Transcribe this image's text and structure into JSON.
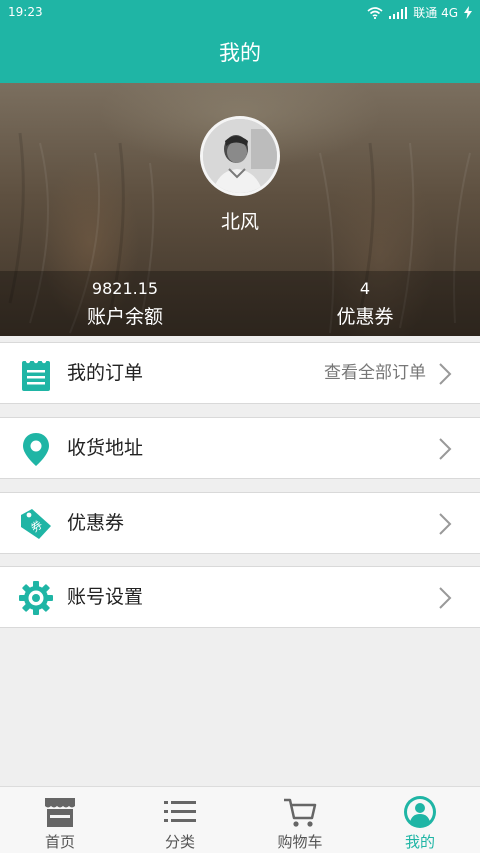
{
  "status_bar": {
    "time": "19:23",
    "carrier": "联通 4G"
  },
  "header": {
    "title": "我的"
  },
  "profile": {
    "username": "北风",
    "balance": {
      "value": "9821.15",
      "label": "账户余额"
    },
    "coupons": {
      "value": "4",
      "label": "优惠券"
    }
  },
  "menu": {
    "orders": {
      "label": "我的订单",
      "extra": "查看全部订单",
      "icon": "clipboard-icon"
    },
    "address": {
      "label": "收货地址",
      "icon": "location-pin-icon"
    },
    "coupon": {
      "label": "优惠券",
      "icon": "coupon-tag-icon",
      "tag_text": "券"
    },
    "settings": {
      "label": "账号设置",
      "icon": "gear-icon"
    }
  },
  "bottom_nav": [
    {
      "label": "首页",
      "icon": "store-icon"
    },
    {
      "label": "分类",
      "icon": "list-icon"
    },
    {
      "label": "购物车",
      "icon": "cart-icon"
    },
    {
      "label": "我的",
      "icon": "user-icon",
      "active": true
    }
  ],
  "colors": {
    "accent": "#1fb5a5",
    "background": "#efefef"
  }
}
